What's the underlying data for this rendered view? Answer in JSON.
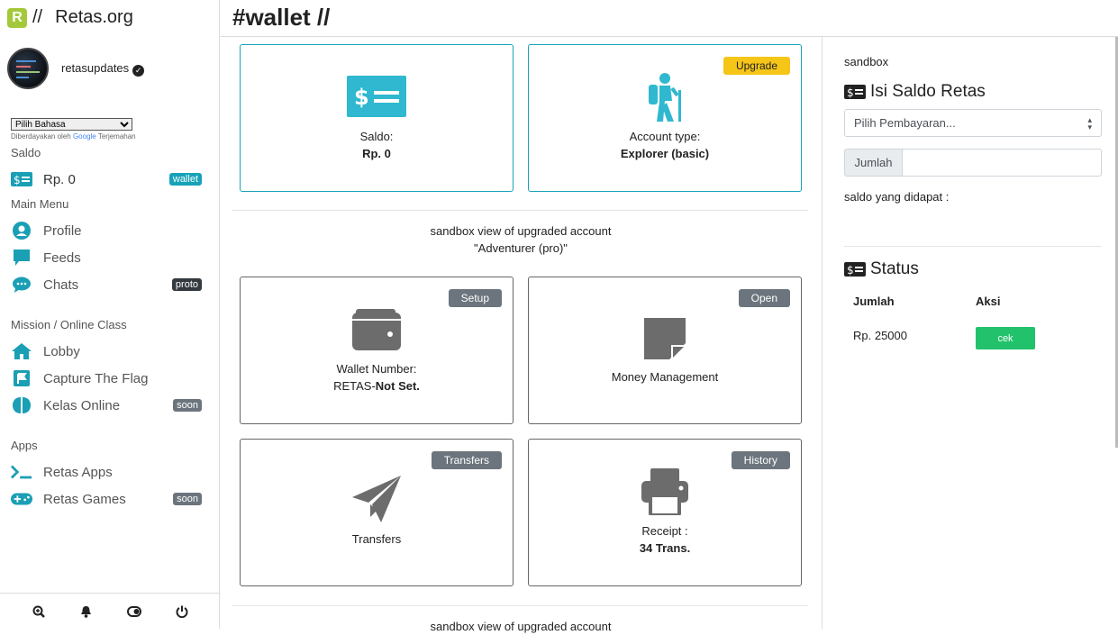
{
  "brand": {
    "logo_letter": "R",
    "slash": "//",
    "name": "Retas.org"
  },
  "user": {
    "name": "retasupdates",
    "verified_icon": "verified-check-icon"
  },
  "language": {
    "select_value": "Pilih Bahasa",
    "powered_prefix": "Diberdayakan oleh",
    "powered_brand": "Google",
    "powered_suffix": "Terjemahan"
  },
  "sidebar": {
    "saldo_heading": "Saldo",
    "saldo": {
      "label": "Rp. 0",
      "badge": "wallet",
      "icon": "money-card-icon"
    },
    "main_menu_heading": "Main Menu",
    "main_menu": [
      {
        "label": "Profile",
        "icon": "user-circle-icon"
      },
      {
        "label": "Feeds",
        "icon": "comment-icon"
      },
      {
        "label": "Chats",
        "icon": "chat-bubbles-icon",
        "badge": "proto"
      }
    ],
    "mission_heading": "Mission / Online Class",
    "mission": [
      {
        "label": "Lobby",
        "icon": "home-icon"
      },
      {
        "label": "Capture The Flag",
        "icon": "flag-icon"
      },
      {
        "label": "Kelas Online",
        "icon": "brain-icon",
        "badge": "soon"
      }
    ],
    "apps_heading": "Apps",
    "apps": [
      {
        "label": "Retas Apps",
        "icon": "terminal-icon"
      },
      {
        "label": "Retas Games",
        "icon": "gamepad-icon",
        "badge": "soon"
      }
    ],
    "bottom_icons": [
      "search-plus-icon",
      "bell-icon",
      "toggle-icon",
      "power-icon"
    ]
  },
  "header": {
    "title": "#wallet //"
  },
  "cards": {
    "saldo": {
      "label": "Saldo:",
      "value": "Rp. 0"
    },
    "account": {
      "label": "Account type:",
      "value": "Explorer (basic)",
      "button": "Upgrade"
    },
    "sandbox_note_line1": "sandbox view of upgraded account",
    "sandbox_note_line2": "\"Adventurer (pro)\"",
    "wallet": {
      "label": "Wallet Number:",
      "prefix": "RETAS-",
      "value": "Not Set.",
      "button": "Setup"
    },
    "money": {
      "label": "Money Management",
      "button": "Open"
    },
    "transfers": {
      "label": "Transfers",
      "button": "Transfers"
    },
    "receipt": {
      "label": "Receipt :",
      "value": "34 Trans.",
      "button": "History"
    },
    "bottom_note": "sandbox view of upgraded account"
  },
  "right": {
    "sandbox_label": "sandbox",
    "topup_title": "Isi Saldo Retas",
    "payment_select": "Pilih Pembayaran...",
    "amount_prefix": "Jumlah",
    "amount_value": "",
    "received_label": "saldo yang didapat :",
    "status_title": "Status",
    "table_headers": [
      "Jumlah",
      "Aksi"
    ],
    "rows": [
      {
        "amount": "Rp. 25000",
        "action": "cek"
      }
    ]
  },
  "colors": {
    "teal": "#17a2b8",
    "yellow": "#f5c518",
    "green": "#21c26b",
    "gray_button": "#6c757d"
  }
}
